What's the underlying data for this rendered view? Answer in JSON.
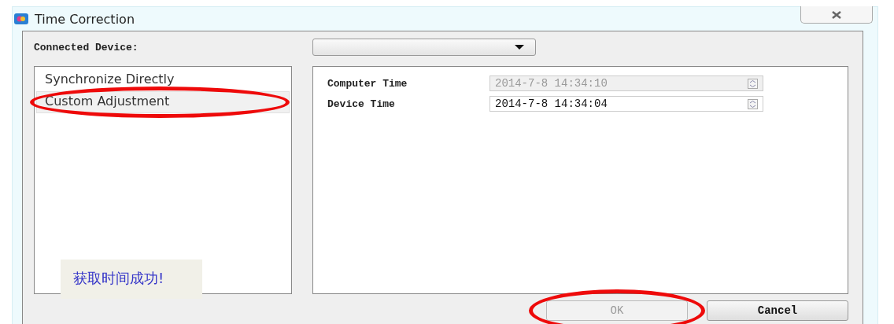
{
  "window": {
    "title": "Time Correction"
  },
  "connected_device": {
    "label": "Connected Device:"
  },
  "modes": [
    {
      "label": "Synchronize Directly",
      "selected": false,
      "circled": false
    },
    {
      "label": "Custom Adjustment",
      "selected": true,
      "circled": true
    }
  ],
  "times": [
    {
      "label": "Computer Time",
      "value": "2014-7-8 14:34:10",
      "disabled": true
    },
    {
      "label": "Device Time",
      "value": "2014-7-8 14:34:04",
      "disabled": false
    }
  ],
  "status_message": "获取时间成功!",
  "buttons": [
    {
      "label": "OK",
      "disabled": true,
      "circled": true
    },
    {
      "label": "Cancel",
      "disabled": false,
      "circled": false
    }
  ]
}
